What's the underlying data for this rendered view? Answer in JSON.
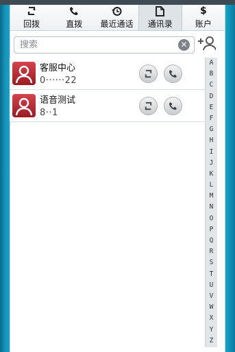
{
  "tabs": [
    {
      "label": "回拨",
      "icon": "callback-icon"
    },
    {
      "label": "直拨",
      "icon": "phone-icon"
    },
    {
      "label": "最近通话",
      "icon": "history-icon"
    },
    {
      "label": "通讯录",
      "icon": "contacts-icon",
      "active": true
    },
    {
      "label": "账户",
      "icon": "dollar-icon"
    }
  ],
  "search": {
    "placeholder": "搜索",
    "value": ""
  },
  "contacts": [
    {
      "name": "客服中心",
      "number": "0······22"
    },
    {
      "name": "语音测试",
      "number": "8··1"
    }
  ],
  "alphabet": [
    "A",
    "B",
    "C",
    "D",
    "E",
    "F",
    "G",
    "H",
    "I",
    "J",
    "K",
    "L",
    "M",
    "N",
    "O",
    "P",
    "Q",
    "R",
    "S",
    "T",
    "U",
    "V",
    "W",
    "X",
    "Y",
    "Z"
  ],
  "colors": {
    "accent_background": "#0e7da2",
    "avatar": "#c5323b",
    "tab_active": "#dde3e7"
  }
}
